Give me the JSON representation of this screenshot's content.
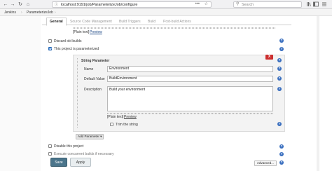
{
  "browser": {
    "url": "localhost:9191/job/ParameterizeJob/configure",
    "search_placeholder": "Search",
    "url_menu_dots": "•••",
    "back_glyph": "←",
    "forward_glyph": "→",
    "reload_glyph": "↻",
    "home_glyph": "⌂",
    "star_glyph": "☆",
    "lock_glyph": "ⓘ",
    "search_glyph": "⚲"
  },
  "breadcrumb": {
    "items": [
      "Jenkins",
      "ParameterizeJob"
    ],
    "separator": "›"
  },
  "tabs": [
    {
      "label": "General",
      "active": true
    },
    {
      "label": "Source Code Management",
      "active": false
    },
    {
      "label": "Build Triggers",
      "active": false
    },
    {
      "label": "Build",
      "active": false
    },
    {
      "label": "Post-build Actions",
      "active": false
    }
  ],
  "top_area": {
    "plain_text": "[Plain text]",
    "preview": "Preview"
  },
  "options": {
    "discard_old_builds": "Discard old builds",
    "parameterized": "This project is parameterized"
  },
  "string_parameter": {
    "title": "String Parameter",
    "close": "X",
    "name_label": "Name",
    "name_value": "Environment",
    "default_label": "Default Value",
    "default_value": "BuildEnvironment",
    "description_label": "Description",
    "description_value": "Build your environment",
    "plain_text": "[Plain text]",
    "preview": "Preview",
    "trim_label": "Trim the string"
  },
  "add_parameter": "Add Parameter ▾",
  "disable_project": "Disable this project",
  "concurrent": "Execute concurrent builds if necessary",
  "advanced": "Advanced...",
  "save": "Save",
  "apply": "Apply",
  "help_glyph": "?",
  "colors": {
    "save_bg": "#4b758b",
    "help_blue": "#3a6fbf",
    "close_red": "#cc2e2e"
  }
}
